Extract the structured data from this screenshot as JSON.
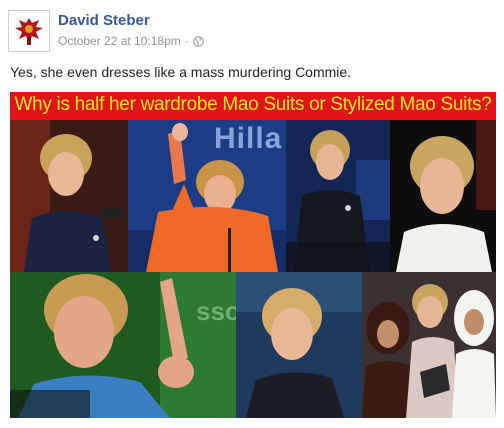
{
  "post": {
    "author": "David Steber",
    "timestamp": "October 22 at 10:18pm",
    "separator": "·",
    "audience_icon": "globe-icon",
    "text": "Yes, she even dresses like a mass murdering Commie."
  },
  "image": {
    "banner": "Why is half her wardrobe Mao Suits or Stylized Mao Suits?",
    "photo_texts": {
      "podium_sign": "Hilla",
      "sign_fragment": "sso"
    }
  },
  "colors": {
    "link": "#365899",
    "meta": "#90949c",
    "banner_bg": "#e01418",
    "banner_text": "#f7e51a"
  }
}
